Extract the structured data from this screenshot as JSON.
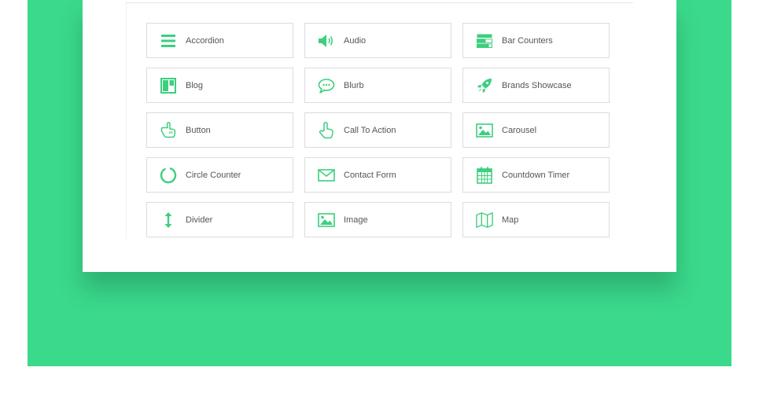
{
  "colors": {
    "background_accent": "#3bd98b",
    "icon": "#3ccf7f",
    "panel": "#ffffff",
    "label_text": "#555555",
    "card_border": "#dcdcdc"
  },
  "modules": [
    {
      "label": "Accordion",
      "icon": "accordion-icon"
    },
    {
      "label": "Audio",
      "icon": "audio-icon"
    },
    {
      "label": "Bar Counters",
      "icon": "bar-counters-icon"
    },
    {
      "label": "Blog",
      "icon": "blog-icon"
    },
    {
      "label": "Blurb",
      "icon": "blurb-icon"
    },
    {
      "label": "Brands Showcase",
      "icon": "rocket-icon"
    },
    {
      "label": "Button",
      "icon": "button-pointer-icon"
    },
    {
      "label": "Call To Action",
      "icon": "call-to-action-pointer-icon"
    },
    {
      "label": "Carousel",
      "icon": "carousel-image-icon"
    },
    {
      "label": "Circle Counter",
      "icon": "circle-counter-icon"
    },
    {
      "label": "Contact Form",
      "icon": "envelope-icon"
    },
    {
      "label": "Countdown Timer",
      "icon": "calendar-icon"
    },
    {
      "label": "Divider",
      "icon": "vertical-arrows-icon"
    },
    {
      "label": "Image",
      "icon": "image-icon"
    },
    {
      "label": "Map",
      "icon": "map-icon"
    }
  ]
}
